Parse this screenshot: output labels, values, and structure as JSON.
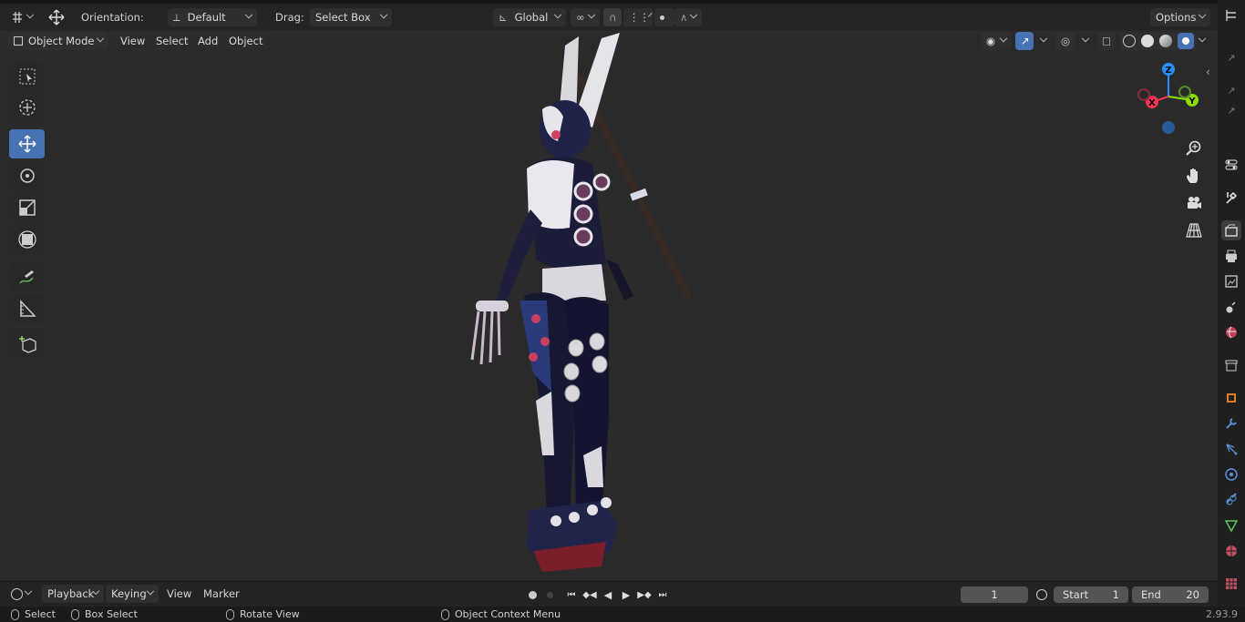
{
  "header": {
    "orientation_label": "Orientation:",
    "orientation_value": "Default",
    "drag_label": "Drag:",
    "drag_value": "Select Box",
    "transform_orientation": "Global",
    "options_label": "Options"
  },
  "viewport_header": {
    "mode": "Object Mode",
    "menus": [
      "View",
      "Select",
      "Add",
      "Object"
    ]
  },
  "gizmo": {
    "z": "Z",
    "y": "Y",
    "x": "X"
  },
  "timeline": {
    "menus": [
      "Playback",
      "Keying",
      "View",
      "Marker"
    ],
    "current_frame": "1",
    "start_label": "Start",
    "start_value": "1",
    "end_label": "End",
    "end_value": "20"
  },
  "statusbar": {
    "select": "Select",
    "box_select": "Box Select",
    "rotate_view": "Rotate View",
    "context_menu": "Object Context Menu",
    "version": "2.93.9"
  },
  "colors": {
    "accent": "#4772b3",
    "axis_x": "#ff3352",
    "axis_y": "#8bdc00",
    "axis_z": "#2890ff"
  }
}
